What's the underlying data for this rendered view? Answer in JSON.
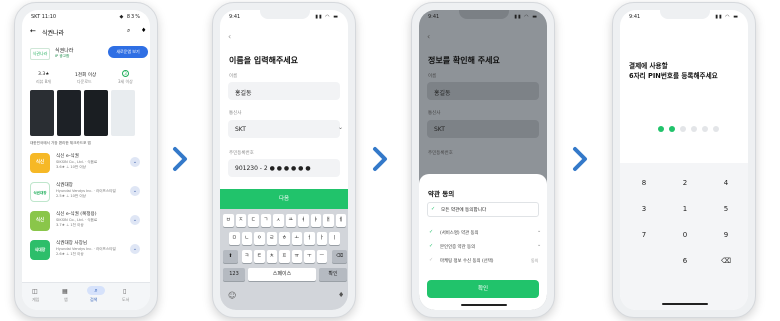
{
  "colors": {
    "brand_green": "#21c36b",
    "arrow_blue": "#3479c9",
    "install_blue": "#2f6fe4"
  },
  "phone1": {
    "status_time": "SKT 11:10",
    "status_right": "◆ 83%",
    "search_text": "식권나라",
    "app_name": "식권나라",
    "app_sub": "IP 광고함",
    "logo_text": "식권나라",
    "install_label": "새로운앱 보기",
    "stats": [
      {
        "value": "3.3★",
        "label": "리뷰 8개"
      },
      {
        "value": "1천회 이상",
        "label": "다운로드"
      },
      {
        "value": "3",
        "label": "3세 이상"
      }
    ],
    "shot_caption": "대한민국에서 가장 편리한 체크카드포 앱",
    "apps": [
      {
        "icon_text": "식신",
        "name": "식신 e-식권",
        "dev": "SIKSIN Co., Ltd. · 식음료",
        "meta": "3.6★  ⊥ 10만 이상",
        "color": "#f6b826"
      },
      {
        "icon_text": "식권대장",
        "name": "식권대장",
        "dev": "Hyundai Vendys Inc. · 라이프스타일",
        "meta": "2.5★  ⊥ 10만 이상",
        "color": "#ffffff"
      },
      {
        "icon_text": "식신",
        "name": "식신 e-식권 (복정용)",
        "dev": "SIKSIN Co., Ltd. · 식음료",
        "meta": "3.7★  ⊥ 1천 이상",
        "color": "#8ac64a"
      },
      {
        "icon_text": "식대장",
        "name": "식권대장 사장님",
        "dev": "Hyundai Vendys Inc. · 라이프스타일",
        "meta": "2.6★  ⊥ 1천 이상",
        "color": "#2dbe6a"
      }
    ],
    "nav": [
      "게임",
      "앱",
      "검색",
      "도서"
    ]
  },
  "phone2": {
    "time": "9:41",
    "title": "이름을 입력해주세요",
    "name_label": "이름",
    "name_value": "홍길동",
    "carrier_label": "통신사",
    "carrier_value": "SKT",
    "rrn_label": "주민등록번호",
    "rrn_value": "901230  -  2 ● ● ● ● ● ●",
    "next_label": "다음",
    "kb_row1": [
      "ㅂ",
      "ㅈ",
      "ㄷ",
      "ㄱ",
      "ㅅ",
      "ㅛ",
      "ㅕ",
      "ㅑ",
      "ㅐ",
      "ㅔ"
    ],
    "kb_row2": [
      "ㅁ",
      "ㄴ",
      "ㅇ",
      "ㄹ",
      "ㅎ",
      "ㅗ",
      "ㅓ",
      "ㅏ",
      "ㅣ"
    ],
    "kb_row3": [
      "ㅋ",
      "ㅌ",
      "ㅊ",
      "ㅍ",
      "ㅠ",
      "ㅜ",
      "ㅡ"
    ],
    "kb_123": "123",
    "kb_space": "스페이스",
    "kb_ok": "확인"
  },
  "phone3": {
    "time": "9:41",
    "title": "정보를 확인해 주세요",
    "name_label": "이름",
    "name_value": "홍길동",
    "carrier_label": "통신사",
    "carrier_value": "SKT",
    "rrn_label": "주민등록번호",
    "sheet_title": "약관 동의",
    "all_agree": "모든 약관에 동의합니다",
    "terms": [
      {
        "label": "(서비스명) 약관 동의",
        "extra": ""
      },
      {
        "label": "본인인증 약관 동의",
        "extra": ""
      },
      {
        "label": "마케팅 정보 수신 동의 (선택)",
        "extra": "동의"
      }
    ],
    "confirm_label": "확인"
  },
  "phone4": {
    "time": "9:41",
    "title_line1": "결제에 사용할",
    "title_line2": "6자리 PIN번호를 등록해주세요",
    "pin_filled": 2,
    "pin_total": 6,
    "keys": [
      "8",
      "2",
      "4",
      "3",
      "1",
      "5",
      "7",
      "0",
      "9",
      "",
      "6",
      "⌫"
    ]
  }
}
